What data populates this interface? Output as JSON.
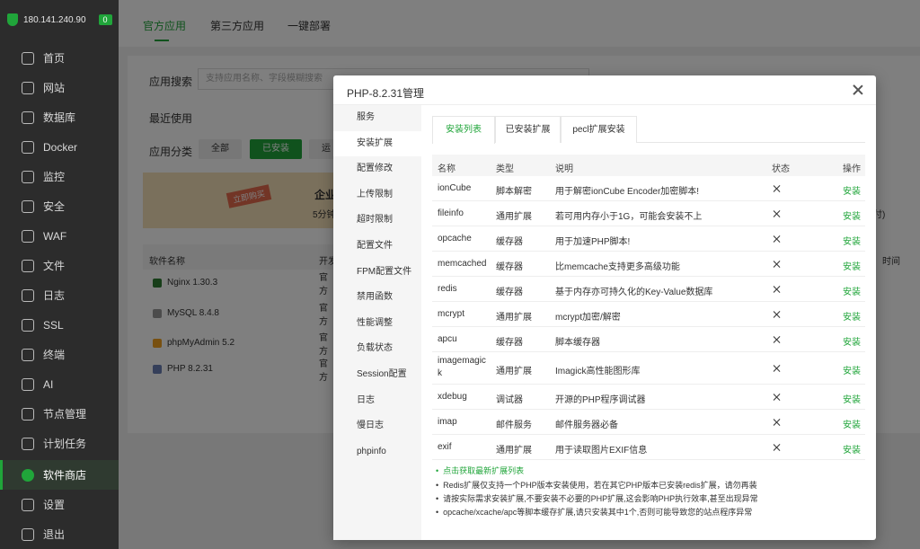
{
  "sidebar": {
    "ip": "180.141.240.90",
    "badge": "0",
    "items": [
      {
        "label": "首页",
        "icon": "home-icon"
      },
      {
        "label": "网站",
        "icon": "website-icon"
      },
      {
        "label": "数据库",
        "icon": "database-icon"
      },
      {
        "label": "Docker",
        "icon": "docker-icon"
      },
      {
        "label": "监控",
        "icon": "monitor-icon"
      },
      {
        "label": "安全",
        "icon": "security-icon"
      },
      {
        "label": "WAF",
        "icon": "waf-icon"
      },
      {
        "label": "文件",
        "icon": "folder-icon"
      },
      {
        "label": "日志",
        "icon": "log-icon"
      },
      {
        "label": "SSL",
        "icon": "ssl-icon"
      },
      {
        "label": "终端",
        "icon": "terminal-icon"
      },
      {
        "label": "AI",
        "icon": "ai-icon"
      },
      {
        "label": "节点管理",
        "icon": "node-icon"
      },
      {
        "label": "计划任务",
        "icon": "cron-icon"
      },
      {
        "label": "软件商店",
        "icon": "store-icon"
      },
      {
        "label": "设置",
        "icon": "settings-icon"
      },
      {
        "label": "退出",
        "icon": "logout-icon"
      }
    ],
    "active_index": 14
  },
  "main": {
    "tabs": [
      "官方应用",
      "第三方应用",
      "一键部署"
    ],
    "search_label": "应用搜索",
    "search_placeholder": "支持应用名称、字段模糊搜索",
    "recent_label": "最近使用",
    "category_label": "应用分类",
    "categories": [
      "全部",
      "已安装",
      "运"
    ],
    "banner_ribbon": "立即购买",
    "banner_title": "企业",
    "banner_sub": "5分钟",
    "partial_right": "付)",
    "partial_time_header": "时间",
    "table_header": [
      "软件名称",
      "开发"
    ],
    "software": [
      {
        "name": "Nginx 1.30.3",
        "dev": "官方"
      },
      {
        "name": "MySQL 8.4.8",
        "dev": "官方"
      },
      {
        "name": "phpMyAdmin 5.2",
        "dev": "官方"
      },
      {
        "name": "PHP 8.2.31",
        "dev": "官方"
      }
    ]
  },
  "modal": {
    "title": "PHP-8.2.31管理",
    "nav": [
      "服务",
      "安装扩展",
      "配置修改",
      "上传限制",
      "超时限制",
      "配置文件",
      "FPM配置文件",
      "禁用函数",
      "性能调整",
      "负载状态",
      "Session配置",
      "日志",
      "慢日志",
      "phpinfo"
    ],
    "nav_active": 1,
    "subtabs": [
      "安装列表",
      "已安装扩展",
      "pecl扩展安装"
    ],
    "subtab_active": 0,
    "columns": [
      "名称",
      "类型",
      "说明",
      "状态",
      "操作"
    ],
    "rows": [
      {
        "name": "ionCube",
        "type": "脚本解密",
        "desc": "用于解密ionCube Encoder加密脚本!",
        "action": "安装"
      },
      {
        "name": "fileinfo",
        "type": "通用扩展",
        "desc": "若可用内存小于1G，可能会安装不上",
        "action": "安装"
      },
      {
        "name": "opcache",
        "type": "缓存器",
        "desc": "用于加速PHP脚本!",
        "action": "安装"
      },
      {
        "name": "memcached",
        "type": "缓存器",
        "desc": "比memcache支持更多高级功能",
        "action": "安装"
      },
      {
        "name": "redis",
        "type": "缓存器",
        "desc": "基于内存亦可持久化的Key-Value数据库",
        "action": "安装"
      },
      {
        "name": "mcrypt",
        "type": "通用扩展",
        "desc": "mcrypt加密/解密",
        "action": "安装"
      },
      {
        "name": "apcu",
        "type": "缓存器",
        "desc": "脚本缓存器",
        "action": "安装"
      },
      {
        "name": "imagemagick",
        "name_line1": "imagemagic",
        "name_line2": "k",
        "type": "通用扩展",
        "desc": "Imagick高性能图形库",
        "action": "安装"
      },
      {
        "name": "xdebug",
        "type": "调试器",
        "desc": "开源的PHP程序调试器",
        "action": "安装"
      },
      {
        "name": "imap",
        "type": "邮件服务",
        "desc": "邮件服务器必备",
        "action": "安装"
      },
      {
        "name": "exif",
        "type": "通用扩展",
        "desc": "用于读取图片EXIF信息",
        "action": "安装"
      }
    ],
    "notes": [
      "点击获取最新扩展列表",
      "Redis扩展仅支持一个PHP版本安装使用，若在其它PHP版本已安装redis扩展，请勿再装",
      "请按实际需求安装扩展,不要安装不必要的PHP扩展,这会影响PHP执行效率,甚至出现异常",
      "opcache/xcache/apc等脚本缓存扩展,请只安装其中1个,否则可能导致您的站点程序异常"
    ]
  },
  "colors": {
    "accent": "#20a53a",
    "sidebar_bg": "#2c2c2c"
  }
}
